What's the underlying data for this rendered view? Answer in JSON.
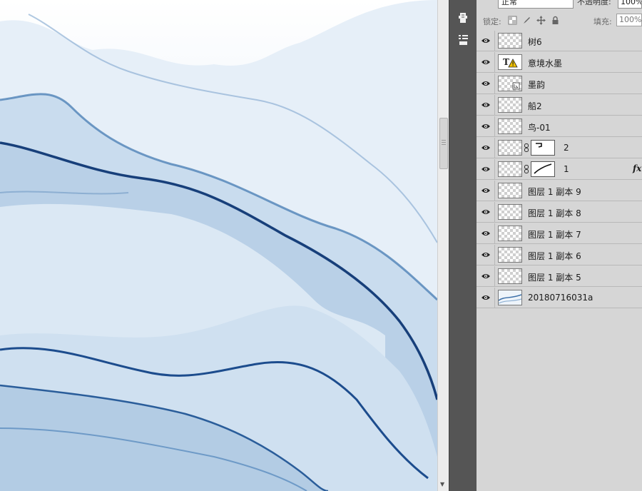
{
  "layers_panel": {
    "blend_mode": "正常",
    "opacity_label": "不透明度:",
    "opacity_value": "100%",
    "lock_label": "锁定:",
    "fill_label": "填充:",
    "fill_value": "100%",
    "layers": [
      {
        "name": "树6",
        "type": "pixel",
        "visible": true
      },
      {
        "name": "意境水墨",
        "type": "text-warning",
        "visible": true
      },
      {
        "name": "墨韵",
        "type": "smart-object",
        "visible": true
      },
      {
        "name": "船2",
        "type": "pixel",
        "visible": true
      },
      {
        "name": "鸟-01",
        "type": "pixel",
        "visible": true
      },
      {
        "name": "2",
        "type": "masked",
        "visible": true
      },
      {
        "name": "1",
        "type": "masked",
        "visible": true,
        "effects": "fx"
      },
      {
        "name": "图层 1 副本 9",
        "type": "pixel",
        "visible": true
      },
      {
        "name": "图层 1 副本 8",
        "type": "pixel",
        "visible": true
      },
      {
        "name": "图层 1 副本 7",
        "type": "pixel",
        "visible": true
      },
      {
        "name": "图层 1 副本 6",
        "type": "pixel",
        "visible": true
      },
      {
        "name": "图层 1 副本 5",
        "type": "pixel",
        "visible": true
      },
      {
        "name": "20180716031a",
        "type": "image",
        "visible": true
      }
    ]
  },
  "colors": {
    "ink_dark": "#0e2f63",
    "ink_mid": "#3f76ad",
    "ink_light": "#bcd3e8",
    "paper": "#f4f8fc",
    "panel_bg": "#d6d6d6",
    "dock_bg": "#555555"
  },
  "dock_tools": [
    "paint-bucket-icon",
    "adjustment-list-icon"
  ]
}
